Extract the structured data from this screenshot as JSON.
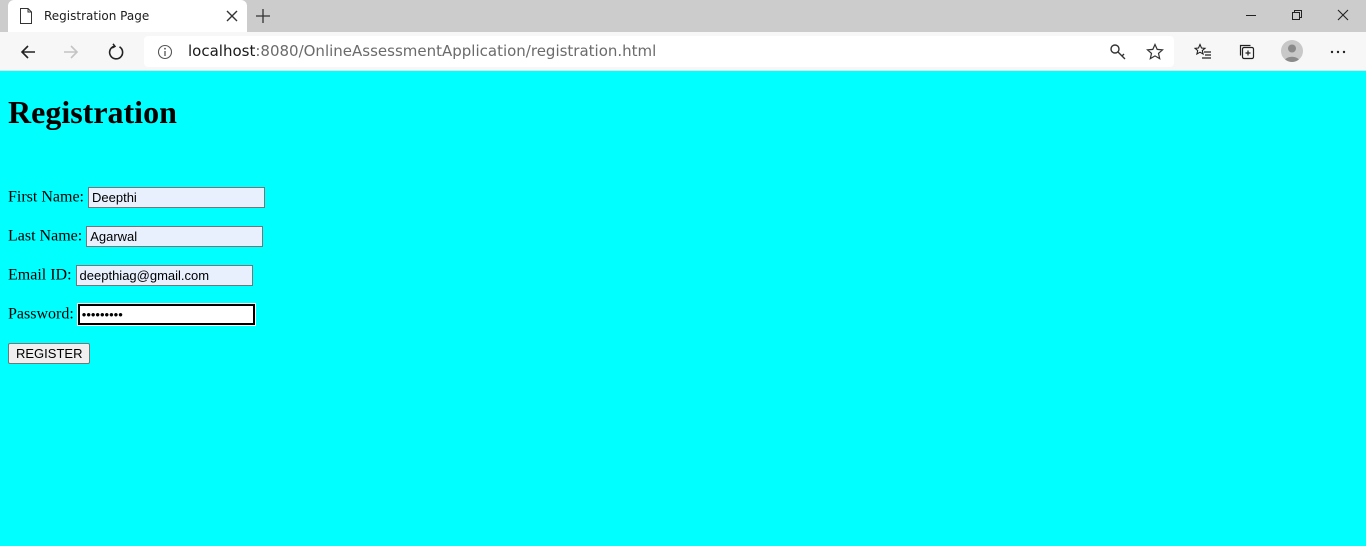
{
  "browser": {
    "tab_title": "Registration Page",
    "url_host": "localhost",
    "url_path": ":8080/OnlineAssessmentApplication/registration.html"
  },
  "page": {
    "heading": "Registration",
    "fields": {
      "first_name": {
        "label": "First Name:",
        "value": "Deepthi"
      },
      "last_name": {
        "label": "Last Name:",
        "value": "Agarwal"
      },
      "email": {
        "label": "Email ID:",
        "value": "deepthiag@gmail.com"
      },
      "password": {
        "label": "Password:",
        "value": "abc123xyz"
      }
    },
    "register_label": "REGISTER"
  },
  "colors": {
    "page_background": "#00ffff",
    "autofill_background": "#e8f0fe"
  },
  "icons": [
    "page-icon",
    "close-icon",
    "plus-icon",
    "minimize-icon",
    "restore-icon",
    "close-window-icon",
    "back-arrow-icon",
    "forward-arrow-icon",
    "refresh-icon",
    "info-icon",
    "key-icon",
    "star-icon",
    "favorites-icon",
    "collections-icon",
    "profile-icon",
    "more-icon"
  ]
}
